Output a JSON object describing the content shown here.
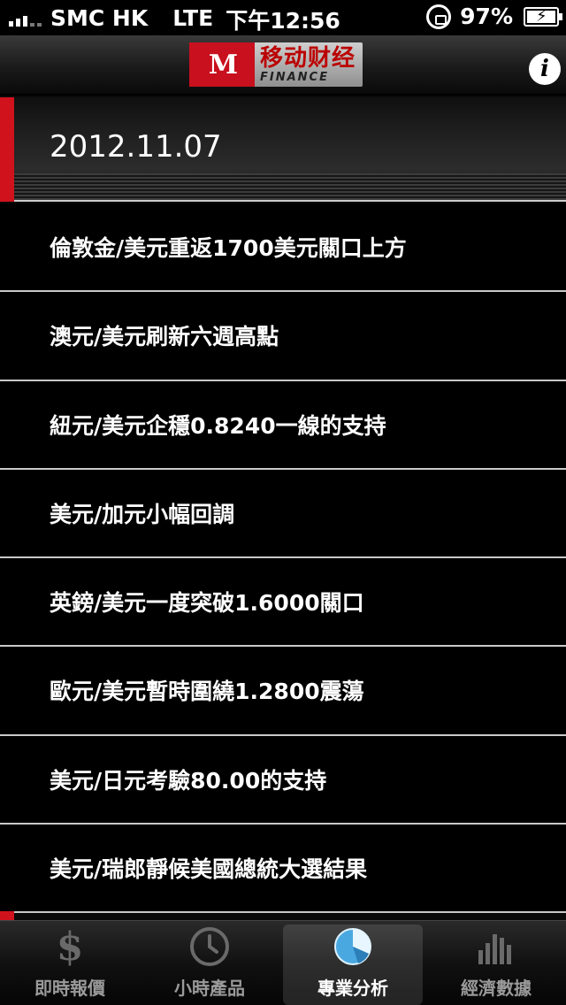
{
  "status_bar": {
    "carrier": "SMC HK",
    "network": "LTE",
    "time": "下午12:56",
    "battery": "97%"
  },
  "header": {
    "logo_cn": "移动财经",
    "logo_en": "FINANCE",
    "info_icon": "info-icon"
  },
  "date": "2012.11.07",
  "news": [
    "倫敦金/美元重返1700美元關口上方",
    "澳元/美元刷新六週高點",
    "紐元/美元企穩0.8240一線的支持",
    "美元/加元小幅回調",
    "英鎊/美元一度突破1.6000關口",
    "歐元/美元暫時圍繞1.2800震蕩",
    "美元/日元考驗80.00的支持",
    "美元/瑞郎靜候美國總統大選結果"
  ],
  "tabs": [
    {
      "label": "即時報價",
      "icon": "dollar-icon"
    },
    {
      "label": "小時產品",
      "icon": "clock-icon"
    },
    {
      "label": "專業分析",
      "icon": "pie-chart-icon",
      "active": true
    },
    {
      "label": "經濟數據",
      "icon": "bar-chart-icon"
    }
  ],
  "colors": {
    "accent_red": "#d0121d",
    "active_tab_icon": "#4aa8e0"
  }
}
